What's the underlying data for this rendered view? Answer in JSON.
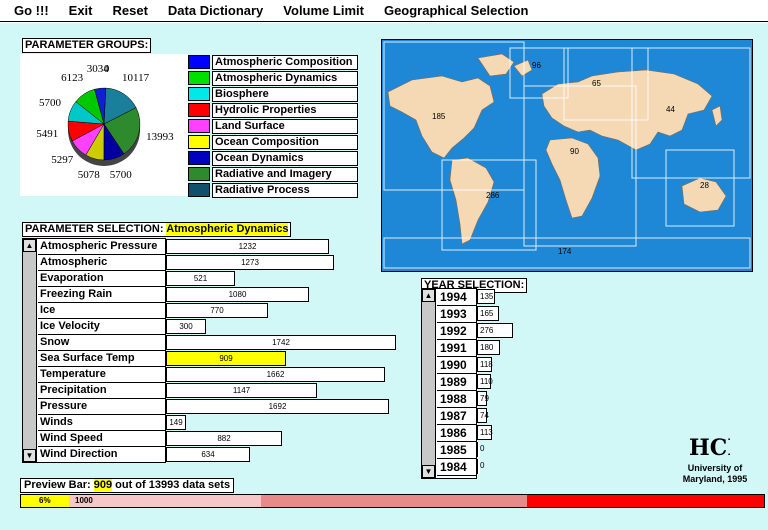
{
  "menu": [
    "Go !!!",
    "Exit",
    "Reset",
    "Data Dictionary",
    "Volume Limit",
    "Geographical Selection"
  ],
  "parameter_groups": {
    "title": "PARAMETER GROUPS:",
    "pie_values": [
      10117,
      13993,
      5700,
      5078,
      5297,
      5491,
      5700,
      6123,
      3034,
      0
    ],
    "pie_labels": [
      "10117",
      "13993",
      "5700",
      "5078",
      "5297",
      "5491",
      "5700",
      "6123",
      "3034",
      "0"
    ],
    "pie_colors": [
      "#1a7f9a",
      "#2d8a2d",
      "#0000a0",
      "#cccc00",
      "#ff40ff",
      "#ff0000",
      "#00c8c8",
      "#00c800",
      "#1020d0",
      "#0000ff"
    ],
    "legend": [
      {
        "label": "Atmospheric Composition",
        "color": "#0000ff",
        "selected": false
      },
      {
        "label": "Atmospheric Dynamics",
        "color": "#00e000",
        "selected": true
      },
      {
        "label": "Biosphere",
        "color": "#00e8e8",
        "selected": false
      },
      {
        "label": "Hydrolic Properties",
        "color": "#ff0000",
        "selected": false
      },
      {
        "label": "Land Surface",
        "color": "#ff40ff",
        "selected": false
      },
      {
        "label": "Ocean Composition",
        "color": "#ffff00",
        "selected": false
      },
      {
        "label": "Ocean Dynamics",
        "color": "#0000c0",
        "selected": false
      },
      {
        "label": "Radiative and Imagery",
        "color": "#2d8a2d",
        "selected": false
      },
      {
        "label": "Radiative Process",
        "color": "#10506a",
        "selected": false
      }
    ]
  },
  "map": {
    "counts": [
      "96",
      "65",
      "44",
      "185",
      "90",
      "28",
      "286",
      "174"
    ]
  },
  "parameter_selection": {
    "title": "PARAMETER SELECTION:",
    "selected_group": "Atmospheric Dynamics",
    "max": 1742,
    "rows": [
      {
        "label": "Atmospheric Pressure",
        "value": 1232,
        "selected": false
      },
      {
        "label": "Atmospheric",
        "value": 1273,
        "selected": false
      },
      {
        "label": "Evaporation",
        "value": 521,
        "selected": false
      },
      {
        "label": "Freezing Rain",
        "value": 1080,
        "selected": false
      },
      {
        "label": "Ice",
        "value": 770,
        "selected": false
      },
      {
        "label": "Ice Velocity",
        "value": 300,
        "selected": false
      },
      {
        "label": "Snow",
        "value": 1742,
        "selected": false
      },
      {
        "label": "Sea Surface Temp",
        "value": 909,
        "selected": true
      },
      {
        "label": "Temperature",
        "value": 1662,
        "selected": false
      },
      {
        "label": "Precipitation",
        "value": 1147,
        "selected": false
      },
      {
        "label": "Pressure",
        "value": 1692,
        "selected": false
      },
      {
        "label": "Winds",
        "value": 149,
        "selected": false
      },
      {
        "label": "Wind Speed",
        "value": 882,
        "selected": false
      },
      {
        "label": "Wind Direction",
        "value": 634,
        "selected": false
      }
    ]
  },
  "year_selection": {
    "title": "YEAR SELECTION:",
    "max": 276,
    "rows": [
      {
        "year": "1994",
        "value": 135
      },
      {
        "year": "1993",
        "value": 165
      },
      {
        "year": "1992",
        "value": 276
      },
      {
        "year": "1991",
        "value": 180
      },
      {
        "year": "1990",
        "value": 118
      },
      {
        "year": "1989",
        "value": 110
      },
      {
        "year": "1988",
        "value": 79
      },
      {
        "year": "1987",
        "value": 74
      },
      {
        "year": "1986",
        "value": 113
      },
      {
        "year": "1985",
        "value": 0
      },
      {
        "year": "1984",
        "value": 0
      }
    ]
  },
  "logo": {
    "text": "HCIL",
    "caption": "University of Maryland, 1995"
  },
  "preview": {
    "prefix": "Preview Bar:",
    "count": "909",
    "suffix": "out of 13993 data sets",
    "percent_label": "6%",
    "limit_label": "1000",
    "fraction": 0.065
  }
}
